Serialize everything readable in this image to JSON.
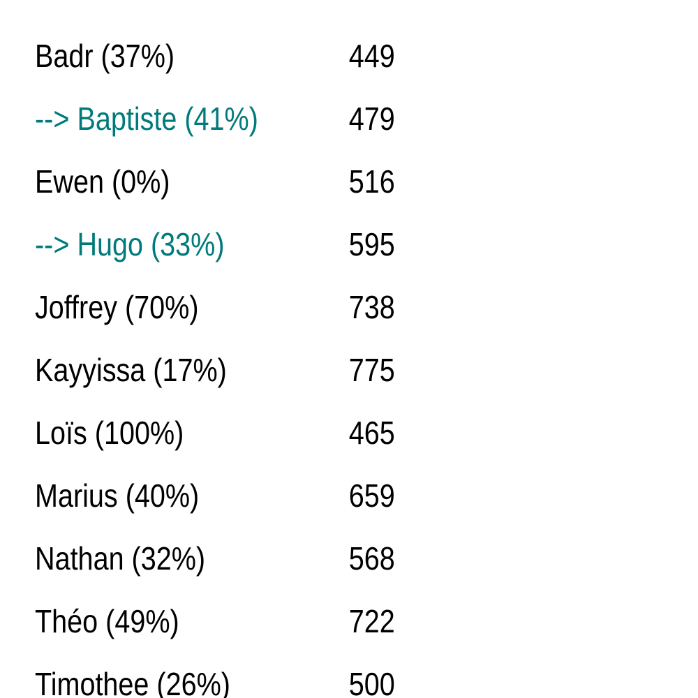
{
  "colors": {
    "text": "#000000",
    "highlight": "#007a7a",
    "background": "#ffffff"
  },
  "rows": [
    {
      "label": "Badr (37%)",
      "value": "449",
      "highlighted": false
    },
    {
      "label": "--> Baptiste (41%)",
      "value": "479",
      "highlighted": true
    },
    {
      "label": "Ewen (0%)",
      "value": "516",
      "highlighted": false
    },
    {
      "label": "--> Hugo (33%)",
      "value": "595",
      "highlighted": true
    },
    {
      "label": "Joffrey (70%)",
      "value": "738",
      "highlighted": false
    },
    {
      "label": "Kayyissa (17%)",
      "value": "775",
      "highlighted": false
    },
    {
      "label": "Loïs (100%)",
      "value": "465",
      "highlighted": false
    },
    {
      "label": "Marius (40%)",
      "value": "659",
      "highlighted": false
    },
    {
      "label": "Nathan (32%)",
      "value": "568",
      "highlighted": false
    },
    {
      "label": "Théo (49%)",
      "value": "722",
      "highlighted": false
    },
    {
      "label": "Timothee (26%)",
      "value": "500",
      "highlighted": false
    }
  ]
}
